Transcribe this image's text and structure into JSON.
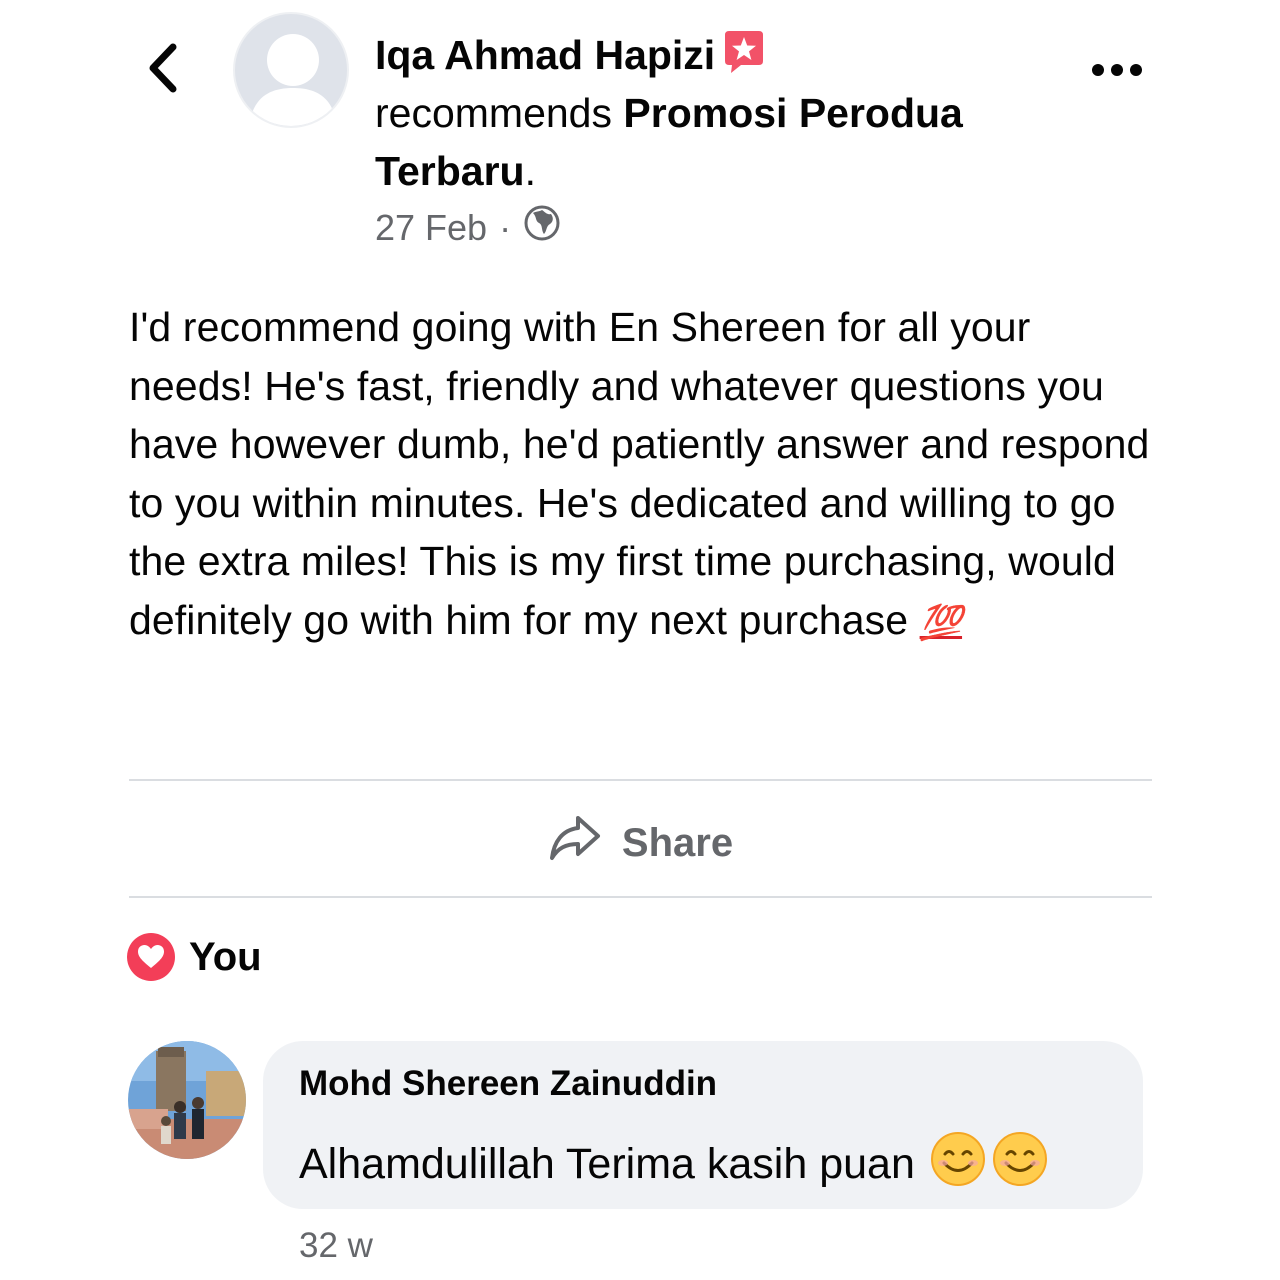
{
  "header": {
    "back_icon": "chevron-left-icon",
    "author_name": "Iqa Ahmad Hapizi",
    "badge_icon": "recommend-star-icon",
    "recommends_text": "recommends",
    "page_name": "Promosi Perodua Terbaru",
    "period": ".",
    "date": "27 Feb",
    "separator": "·",
    "privacy_icon": "globe-icon",
    "more_icon": "more-dots-icon"
  },
  "post": {
    "text": "I'd recommend going with En Shereen for all your needs! He's fast, friendly and whatever questions you have however dumb, he'd patiently answer and respond to you within minutes. He's dedicated and willing to go the extra miles! This is my first time purchasing, would definitely go with him for my next purchase",
    "emoji": "💯"
  },
  "actions": {
    "share_label": "Share",
    "share_icon": "share-arrow-icon"
  },
  "reactions": {
    "icon": "heart-reaction-icon",
    "label": "You"
  },
  "comment": {
    "author": "Mohd Shereen Zainuddin",
    "text": "Alhamdulillah Terima kasih puan",
    "emojis": [
      "smiling-face-icon",
      "smiling-face-icon"
    ],
    "time": "32 w"
  },
  "colors": {
    "text": "#050505",
    "secondary": "#65676b",
    "divider": "#dadde1",
    "bubble": "#f0f2f5",
    "heart": "#f33e58",
    "badge": "#f25268"
  }
}
